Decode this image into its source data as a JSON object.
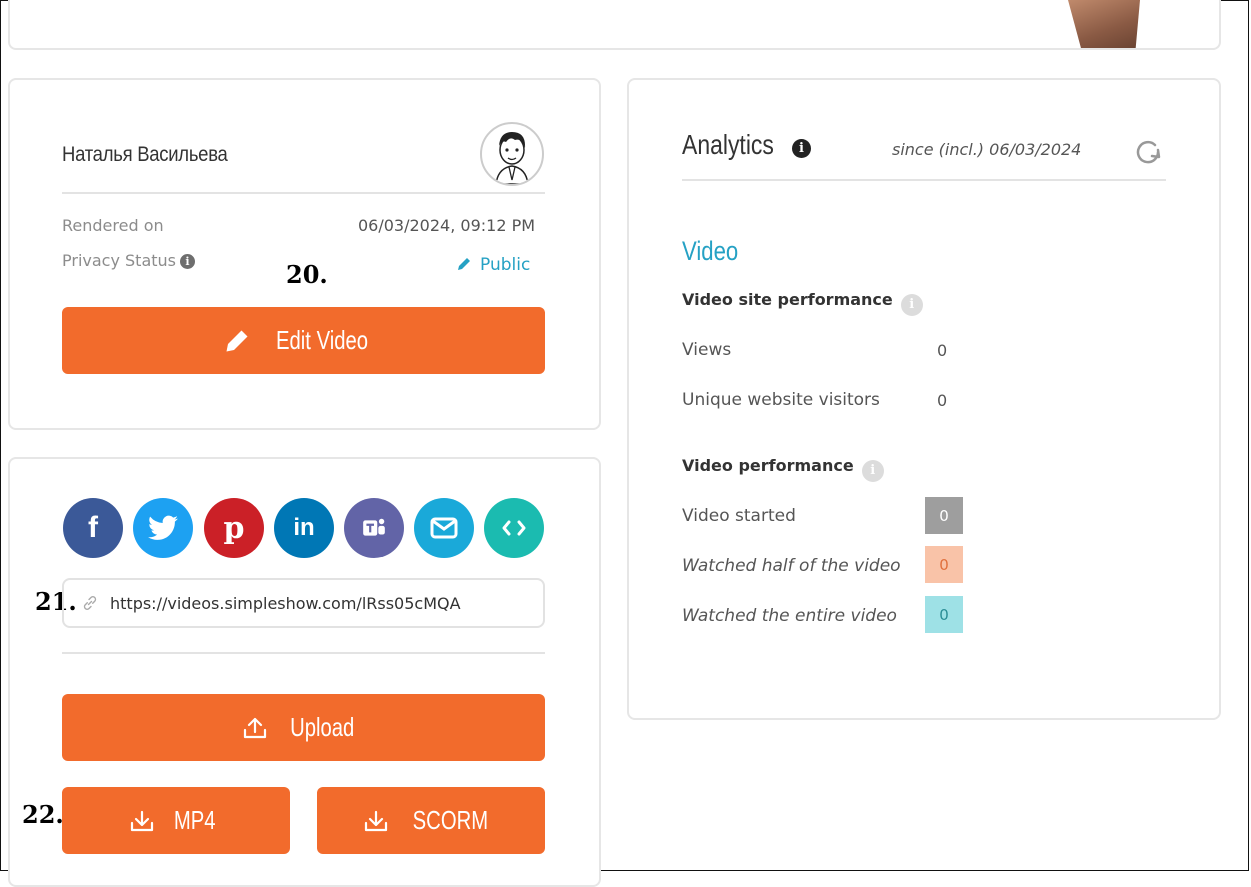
{
  "profile": {
    "author_name": "Наталья Васильева",
    "rendered_label": "Rendered on",
    "rendered_value": "06/03/2024, 09:12 PM",
    "privacy_label": "Privacy Status",
    "privacy_value": "Public",
    "edit_button": "Edit Video"
  },
  "annotations": {
    "a20": "20.",
    "a21": "21.",
    "a22": "22."
  },
  "share": {
    "networks": [
      "facebook",
      "twitter",
      "pinterest",
      "linkedin",
      "teams",
      "email",
      "embed"
    ],
    "url": "https://videos.simpleshow.com/lRss05cMQA",
    "upload_button": "Upload",
    "mp4_button": "MP4",
    "scorm_button": "SCORM"
  },
  "analytics": {
    "title": "Analytics",
    "since": "since (incl.) 06/03/2024",
    "section": "Video",
    "site_performance": {
      "title": "Video site performance",
      "views_label": "Views",
      "views_value": "0",
      "visitors_label": "Unique website visitors",
      "visitors_value": "0"
    },
    "video_performance": {
      "title": "Video performance",
      "started_label": "Video started",
      "started_value": "0",
      "half_label": "Watched half of the video",
      "half_value": "0",
      "entire_label": "Watched the entire video",
      "entire_value": "0"
    }
  },
  "colors": {
    "accent": "#f26b2c",
    "link": "#25a1c4",
    "facebook": "#3b5998",
    "twitter": "#1da1f2",
    "pinterest": "#cb2027",
    "linkedin": "#0077b5",
    "teams": "#6264a7",
    "email": "#1aa9d9",
    "embed": "#1bbbb0",
    "badge_started": "#9e9e9e",
    "badge_half": "#f9c3a8",
    "badge_entire": "#9ee1e6"
  }
}
